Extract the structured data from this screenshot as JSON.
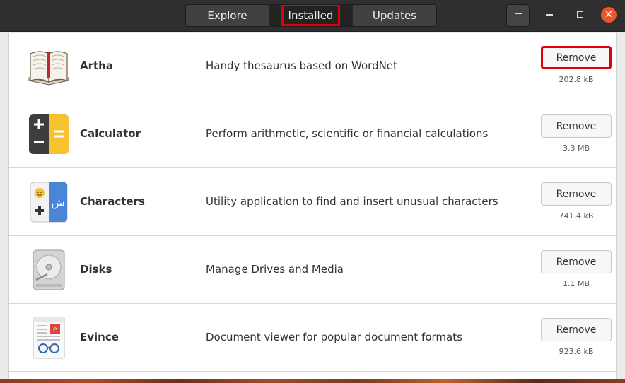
{
  "tabs": {
    "explore": "Explore",
    "installed": "Installed",
    "updates": "Updates"
  },
  "window": {
    "menu_icon": "hamburger-icon",
    "minimize_icon": "minimize-icon",
    "maximize_icon": "maximize-icon",
    "close_icon": "close-icon",
    "close_glyph": "✕"
  },
  "apps": [
    {
      "name": "Artha",
      "description": "Handy thesaurus based on WordNet",
      "action": "Remove",
      "size": "202.8 kB",
      "icon": "book-icon"
    },
    {
      "name": "Calculator",
      "description": "Perform arithmetic, scientific or financial calculations",
      "action": "Remove",
      "size": "3.3 MB",
      "icon": "calculator-icon"
    },
    {
      "name": "Characters",
      "description": "Utility application to find and insert unusual characters",
      "action": "Remove",
      "size": "741.4 kB",
      "icon": "characters-icon"
    },
    {
      "name": "Disks",
      "description": "Manage Drives and Media",
      "action": "Remove",
      "size": "1.1 MB",
      "icon": "disk-icon"
    },
    {
      "name": "Evince",
      "description": "Document viewer for popular document formats",
      "action": "Remove",
      "size": "923.6 kB",
      "icon": "document-viewer-icon"
    }
  ],
  "colors": {
    "highlight": "#e0000b",
    "headerbar": "#2f2f2f",
    "close_button": "#e9562b"
  }
}
